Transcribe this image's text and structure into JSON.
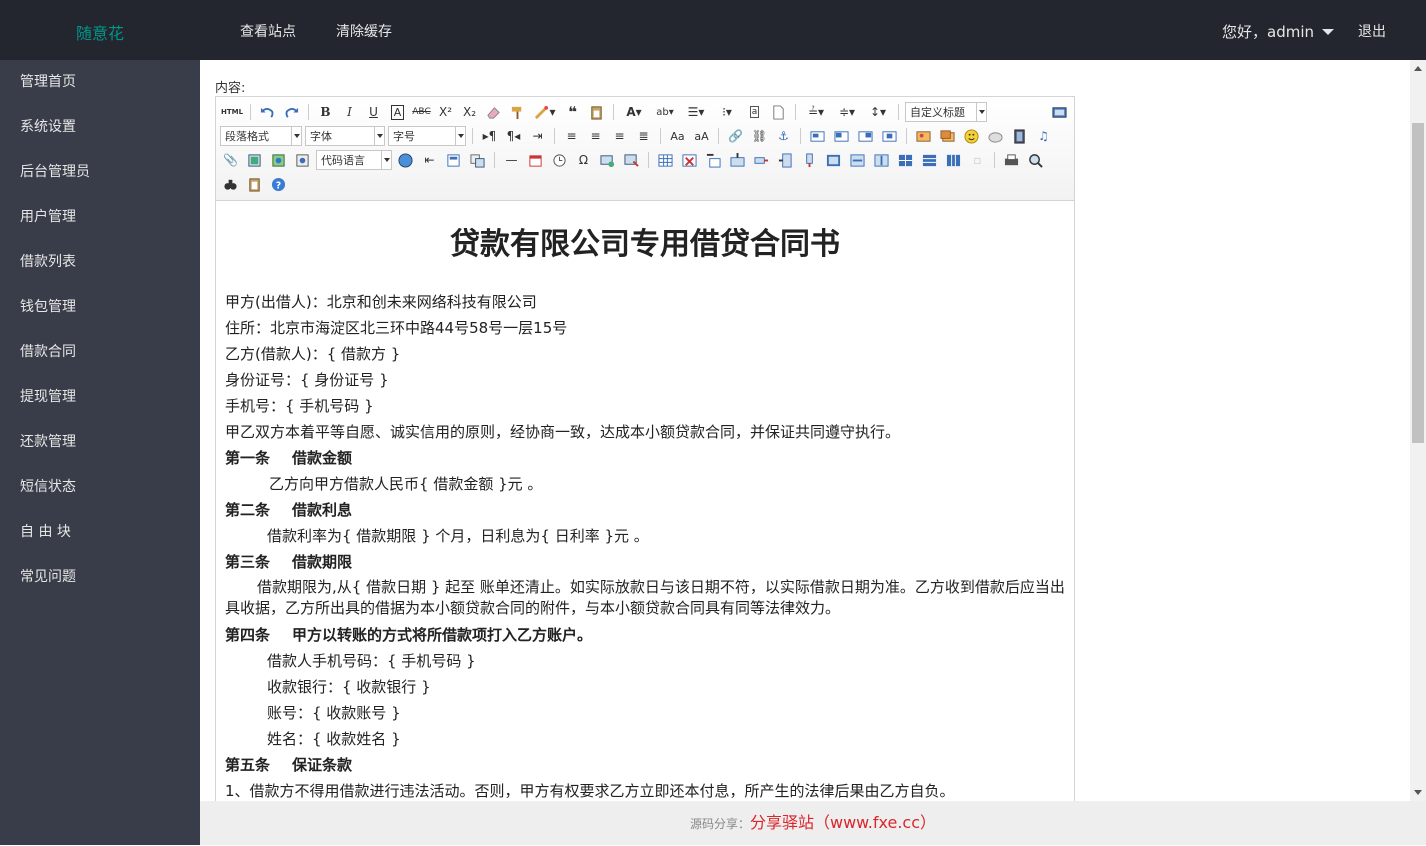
{
  "header": {
    "logo": "随意花",
    "nav": [
      "查看站点",
      "清除缓存"
    ],
    "greeting": "您好，admin",
    "logout": "退出"
  },
  "sidebar": {
    "items": [
      "管理首页",
      "系统设置",
      "后台管理员",
      "用户管理",
      "借款列表",
      "钱包管理",
      "借款合同",
      "提现管理",
      "还款管理",
      "短信状态",
      "自 由 块",
      "常见问题"
    ]
  },
  "editor": {
    "label": "内容:",
    "combos": {
      "custom_title": "自定义标题",
      "paragraph": "段落格式",
      "font": "字体",
      "size": "字号",
      "code_lang": "代码语言"
    }
  },
  "document": {
    "title": "贷款有限公司专用借贷合同书",
    "lines": [
      "甲方(出借人)：北京和创未来网络科技有限公司",
      "住所：北京市海淀区北三环中路44号58号一层15号",
      "乙方(借款人)：{ 借款方 }",
      "身份证号：{ 身份证号 }",
      "手机号：{ 手机号码 }",
      "甲乙双方本着平等自愿、诚实信用的原则，经协商一致，达成本小额贷款合同，并保证共同遵守执行。"
    ],
    "art1": {
      "num": "第一条",
      "title": "借款金额",
      "body": "乙方向甲方借款人民币{ 借款金额 }元 。"
    },
    "art2": {
      "num": "第二条",
      "title": "借款利息",
      "body": "借款利率为{ 借款期限 } 个月，日利息为{ 日利率 }元 。"
    },
    "art3": {
      "num": "第三条",
      "title": "借款期限",
      "body": "借款期限为,从{ 借款日期 } 起至 账单还清止。如实际放款日与该日期不符，以实际借款日期为准。乙方收到借款后应当出具收据，乙方所出具的借据为本小额贷款合同的附件，与本小额贷款合同具有同等法律效力。"
    },
    "art4": {
      "num": "第四条",
      "title": "甲方以转账的方式将所借款项打入乙方账户。",
      "lines": [
        "借款人手机号码：{ 手机号码 }",
        "收款银行：{ 收款银行 }",
        "账号：{ 收款账号 }",
        "姓名：{ 收款姓名 }"
      ]
    },
    "art5": {
      "num": "第五条",
      "title": "保证条款",
      "body": "1、借款方不得用借款进行违法活动。否则，甲方有权要求乙方立即还本付息，所产生的法律后果由乙方自负。"
    }
  },
  "footer": {
    "prefix": "源码分享：",
    "site": "分享驿站（www.fxe.cc）"
  }
}
